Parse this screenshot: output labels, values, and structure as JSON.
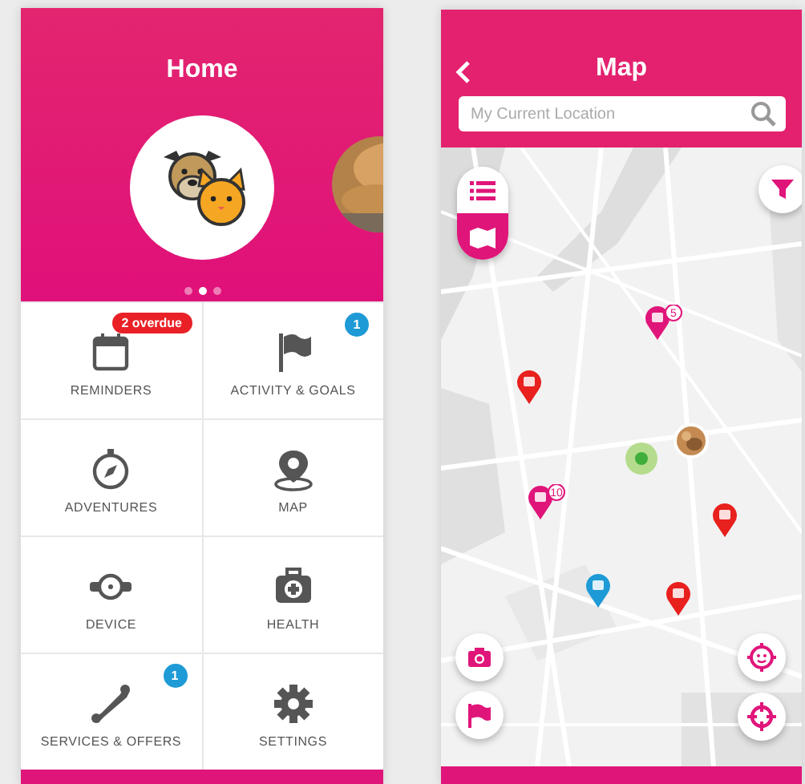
{
  "home": {
    "title": "Home",
    "carousel_dots": [
      {
        "selected": false
      },
      {
        "selected": true
      },
      {
        "selected": false
      }
    ],
    "tiles": [
      {
        "label": "REMINDERS",
        "badge": {
          "text": "2 overdue",
          "kind": "pill"
        }
      },
      {
        "label": "ACTIVITY & GOALS",
        "badge": {
          "text": "1",
          "kind": "count"
        }
      },
      {
        "label": "ADVENTURES"
      },
      {
        "label": "MAP"
      },
      {
        "label": "DEVICE"
      },
      {
        "label": "HEALTH"
      },
      {
        "label": "SERVICES & OFFERS",
        "badge": {
          "text": "1",
          "kind": "count"
        }
      },
      {
        "label": "SETTINGS"
      }
    ]
  },
  "map_screen": {
    "title": "Map",
    "search": {
      "placeholder": "My Current Location"
    },
    "view_toggle": [
      {
        "selected": false
      },
      {
        "selected": true
      }
    ],
    "pins": [
      {
        "kind": "pin",
        "color": "#e0157a",
        "badge": "5"
      },
      {
        "kind": "pin",
        "color": "#e8201e"
      },
      {
        "kind": "avatar"
      },
      {
        "kind": "dot",
        "color": "#3fae3a"
      },
      {
        "kind": "pin",
        "color": "#e0157a",
        "badge": "10"
      },
      {
        "kind": "pin",
        "color": "#e8201e"
      },
      {
        "kind": "pin",
        "color": "#1e9ad6"
      },
      {
        "kind": "pin",
        "color": "#e8201e"
      }
    ]
  }
}
